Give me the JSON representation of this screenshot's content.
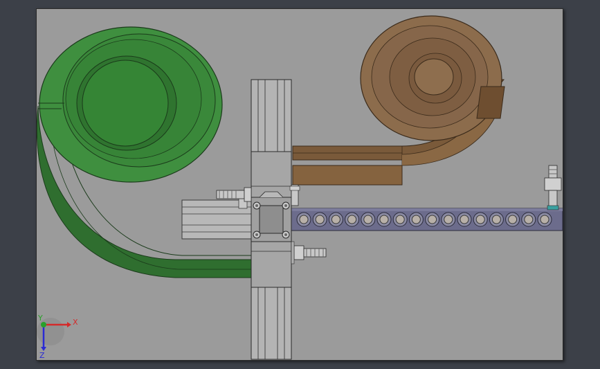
{
  "viewport": {
    "background_color": "#3c4048",
    "sheet_color": "#9b9b9b"
  },
  "model": {
    "parts": [
      {
        "name": "green-spiral-feeder-bowl",
        "color": "#3c8a3c"
      },
      {
        "name": "brown-spiral-feeder-bowl",
        "color": "#8c6c4c"
      },
      {
        "name": "vertical-guide-rail",
        "color": "#b4b4b4"
      },
      {
        "name": "horizontal-pneumatic-cylinder",
        "color": "#b0b0b0"
      },
      {
        "name": "roller-conveyor",
        "color": "#6c6c8c",
        "roller_count": 16
      },
      {
        "name": "adjusting-bolts",
        "color": "#c8c8c8"
      }
    ]
  },
  "triad": {
    "x_label": "X",
    "y_label": "Y",
    "z_label": "Z",
    "x_color": "#d42a2a",
    "y_color": "#2aa02a",
    "z_color": "#2a2ad4"
  }
}
